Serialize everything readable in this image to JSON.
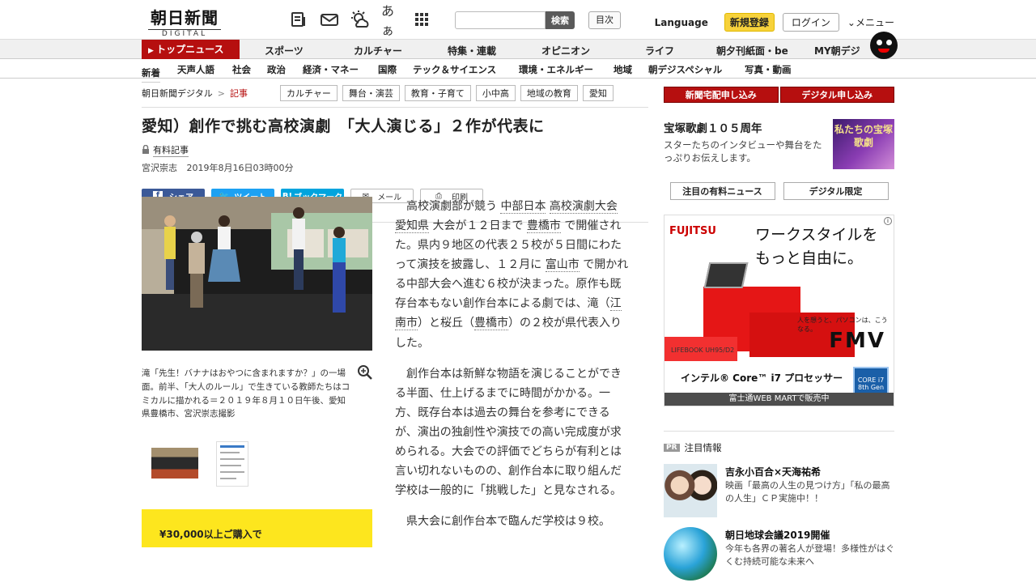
{
  "header": {
    "logo_main": "朝日新聞",
    "logo_sub": "DIGITAL",
    "icons": [
      "newspaper-icon",
      "mail-icon",
      "weather-icon",
      "font-size-icon",
      "grid-icon"
    ],
    "font_label": "あぁ",
    "search_placeholder": "",
    "search_button": "検索",
    "contents_button": "目次",
    "language": "Language",
    "register": "新規登録",
    "login": "ログイン",
    "menu": "メニュー"
  },
  "nav_primary": [
    "トップニュース",
    "スポーツ",
    "カルチャー",
    "特集・連載",
    "オピニオン",
    "ライフ",
    "朝夕刊紙面・be",
    "MY朝デジ"
  ],
  "nav_secondary": [
    "新着",
    "天声人語",
    "社会",
    "政治",
    "経済・マネー",
    "国際",
    "テック＆サイエンス",
    "環境・エネルギー",
    "地域",
    "朝デジスペシャル",
    "写真・動画"
  ],
  "breadcrumb": {
    "home": "朝日新聞デジタル",
    "sep": ">",
    "current": "記事"
  },
  "tags": [
    "カルチャー",
    "舞台・演芸",
    "教育・子育て",
    "小中高",
    "地域の教育",
    "愛知"
  ],
  "article": {
    "headline": "愛知）創作で挑む高校演劇　「大人演じる」２作が代表に",
    "paid_label": "有料記事",
    "author": "宮沢崇志",
    "date": "2019年8月16日03時00分",
    "share": {
      "facebook": "シェア",
      "twitter": "ツイート",
      "hatena": "ブックマーク",
      "mail": "メール",
      "print": "印刷",
      "twitter_sub": "list",
      "hatena_sub": "0"
    },
    "caption": "滝「先生！バナナはおやつに含まれますか？」の一場面。前半、「大人のルール」で生きている教師たちはコミカルに描かれる＝２０１９年８月１０日午後、愛知県豊橋市、宮沢崇志撮影",
    "p1_parts": [
      "高校演劇部が競う ",
      "中部日本",
      "高校演劇大会",
      "愛知県",
      "大会が１２日まで ",
      "豊橋市",
      " で開催された。県内９地区の代表２５校が５日間にわたって演技を披露し、１２月に ",
      "富山市",
      " で開かれる中部大会へ進む６校が決まった。原作も既存台本もない創作台本による劇では、滝（",
      "江南市",
      "）と桜丘（",
      "豊橋市",
      "）の２校が県代表入りした。"
    ],
    "p2": "創作台本は新鮮な物語を演じることができる半面、仕上げるまでに時間がかかる。一方、既存台本は過去の舞台を参考にできるが、演出の独創性や演技での高い完成度が求められる。大会での評価でどちらが有利とは言い切れないものの、創作台本に取り組んだ学校は一般的に「挑戦した」と見なされる。",
    "p3": "県大会に創作台本で臨んだ学校は９校。"
  },
  "ad_yellow": "¥30,000以上ご購入で",
  "sidebar": {
    "btn_newspaper": "新聞宅配申し込み",
    "btn_digital": "デジタル申し込み",
    "takarazuka_title": "宝塚歌劇１０５周年",
    "takarazuka_desc": "スターたちのインタビューや舞台をたっぷりお伝えします。",
    "takarazuka_img_text": "私たちの宝塚歌劇",
    "tab_paid": "注目の有料ニュース",
    "tab_digital": "デジタル限定",
    "ad_brand": "FUJITSU",
    "ad_copy1": "ワークスタイルを",
    "ad_copy2": "もっと自由に。",
    "ad_tagline": "人を想うと、パソコンは、こうなる。",
    "ad_model": "LIFEBOOK UH95/D2",
    "ad_fmv": "FMV",
    "ad_cpu": "インテル® Core™ i7 プロセッサー",
    "ad_intel": "CORE i7 8th Gen",
    "ad_shop": "富士通WEB MARTで販売中",
    "pr_badge": "PR",
    "pr_title": "注目情報",
    "pr_items": [
      {
        "title": "吉永小百合×天海祐希",
        "desc": "映画「最高の人生の見つけ方」「私の最高の人生」ＣＰ実施中！！"
      },
      {
        "title": "朝日地球会議2019開催",
        "desc": "今年も各界の著名人が登場！多様性がはぐくむ持続可能な未来へ"
      }
    ]
  },
  "colors": {
    "brand_red": "#b60f0f",
    "register_yellow": "#f7d23b",
    "facebook": "#3b5998",
    "twitter": "#1da1f2",
    "hatena": "#00a4de"
  }
}
